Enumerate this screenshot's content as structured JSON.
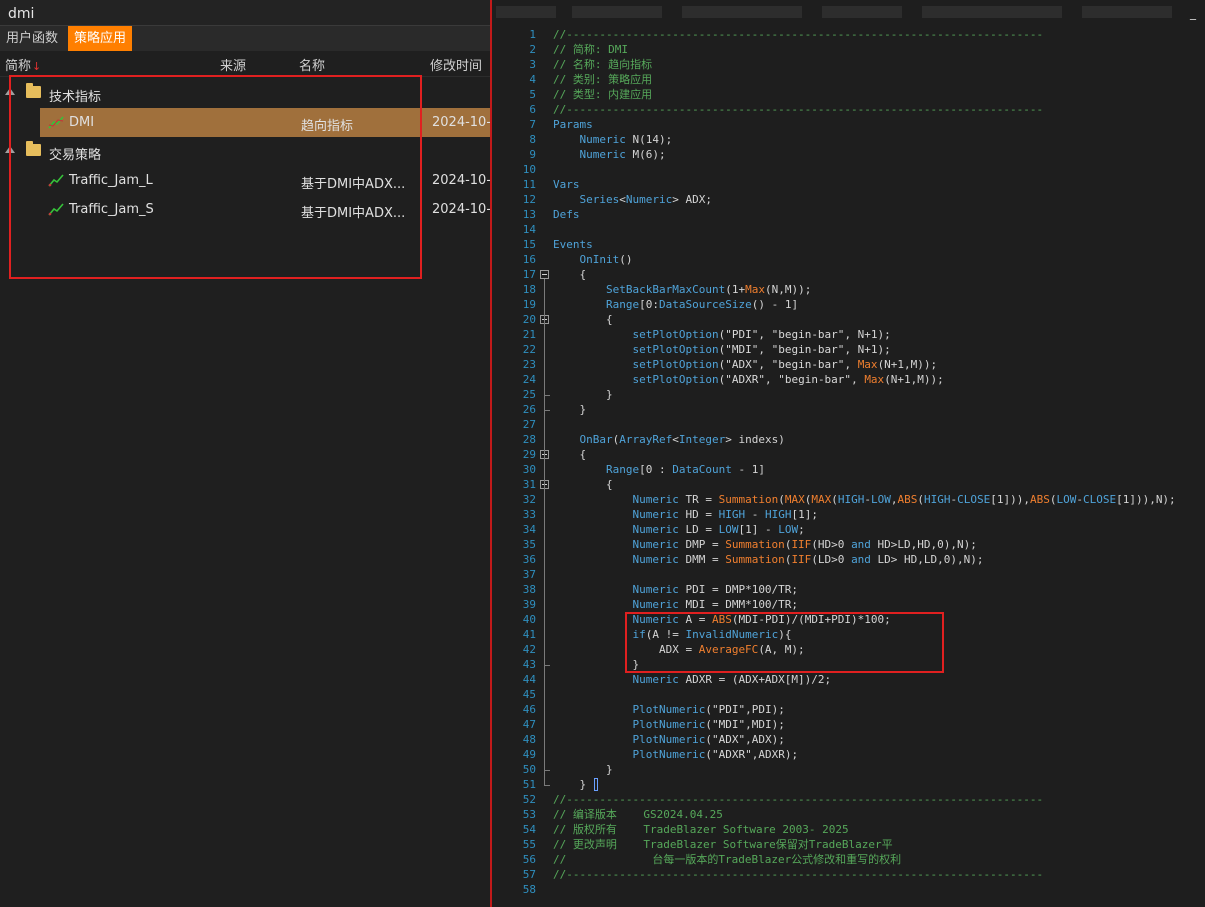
{
  "search": {
    "value": "dmi"
  },
  "tabs": [
    {
      "label": "用户函数"
    },
    {
      "label": "策略应用"
    }
  ],
  "columns": {
    "abbr": "简称",
    "source": "来源",
    "name": "名称",
    "modified": "修改时间"
  },
  "tree": [
    {
      "type": "folder",
      "label": "技术指标"
    },
    {
      "type": "item",
      "abbr": "DMI",
      "name": "趋向指标",
      "modified": "2024-10-",
      "selected": true
    },
    {
      "type": "folder",
      "label": "交易策略"
    },
    {
      "type": "item",
      "abbr": "Traffic_Jam_L",
      "name": "基于DMI中ADX...",
      "modified": "2024-10-"
    },
    {
      "type": "item",
      "abbr": "Traffic_Jam_S",
      "name": "基于DMI中ADX...",
      "modified": "2024-10-"
    }
  ],
  "window": {
    "control": "_"
  },
  "code": [
    "//------------------------------------------------------------------------",
    "// 简称: DMI",
    "// 名称: 趋向指标",
    "// 类别: 策略应用",
    "// 类型: 内建应用",
    "//------------------------------------------------------------------------",
    "Params",
    "    Numeric N(14);",
    "    Numeric M(6);",
    "",
    "Vars",
    "    Series<Numeric> ADX;",
    "Defs",
    "",
    "Events",
    "    OnInit()",
    "    {",
    "        SetBackBarMaxCount(1+Max(N,M));",
    "        Range[0:DataSourceSize() - 1]",
    "        {",
    "            setPlotOption(\"PDI\", \"begin-bar\", N+1);",
    "            setPlotOption(\"MDI\", \"begin-bar\", N+1);",
    "            setPlotOption(\"ADX\", \"begin-bar\", Max(N+1,M));",
    "            setPlotOption(\"ADXR\", \"begin-bar\", Max(N+1,M));",
    "        }",
    "    }",
    "",
    "    OnBar(ArrayRef<Integer> indexs)",
    "    {",
    "        Range[0 : DataCount - 1]",
    "        {",
    "            Numeric TR = Summation(MAX(MAX(HIGH-LOW,ABS(HIGH-CLOSE[1])),ABS(LOW-CLOSE[1])),N);",
    "            Numeric HD = HIGH - HIGH[1];",
    "            Numeric LD = LOW[1] - LOW;",
    "            Numeric DMP = Summation(IIF(HD>0 and HD>LD,HD,0),N);",
    "            Numeric DMM = Summation(IIF(LD>0 and LD> HD,LD,0),N);",
    "",
    "            Numeric PDI = DMP*100/TR;",
    "            Numeric MDI = DMM*100/TR;",
    "            Numeric A = ABS(MDI-PDI)/(MDI+PDI)*100;",
    "            if(A != InvalidNumeric){",
    "                ADX = AverageFC(A, M);",
    "            }",
    "            Numeric ADXR = (ADX+ADX[M])/2;",
    "",
    "            PlotNumeric(\"PDI\",PDI);",
    "            PlotNumeric(\"MDI\",MDI);",
    "            PlotNumeric(\"ADX\",ADX);",
    "            PlotNumeric(\"ADXR\",ADXR);",
    "        }",
    "    }",
    "//------------------------------------------------------------------------",
    "// 编译版本    GS2024.04.25",
    "// 版权所有    TradeBlazer Software 2003- 2025",
    "// 更改声明    TradeBlazer Software保留对TradeBlazer平",
    "//             台每一版本的TradeBlazer公式修改和重写的权利",
    "//------------------------------------------------------------------------",
    ""
  ]
}
